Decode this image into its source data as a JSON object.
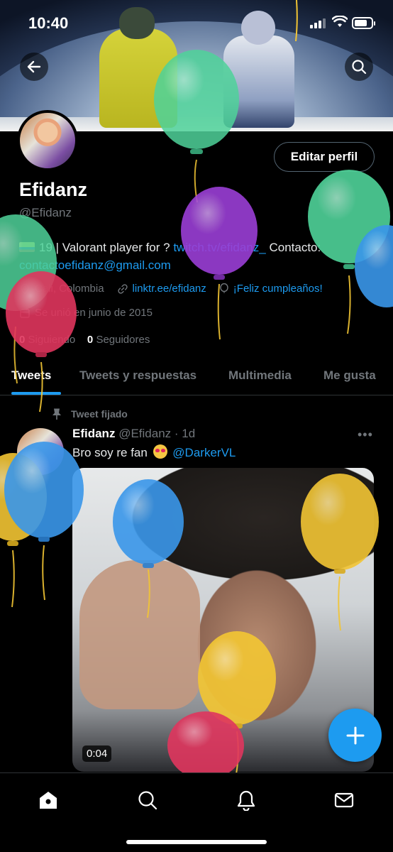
{
  "status_bar": {
    "time": "10:40"
  },
  "profile": {
    "edit_button": "Editar perfil",
    "name": "Efidanz",
    "handle": "@Efidanz",
    "bio_text": "19 | Valorant player for ?",
    "bio_link": "twitch.tv/efidanz_",
    "bio_contact_label": "Contacto:",
    "bio_email": "contactoefidanz@gmail.com",
    "location": "Cali, Colombia",
    "website": "linktr.ee/efidanz",
    "birthday": "¡Feliz cumpleaños!",
    "joined": "Se unió en junio de 2015",
    "following_count": "0",
    "following_label": "Siguiendo",
    "followers_count": "0",
    "followers_label": "Seguidores"
  },
  "tabs": [
    {
      "label": "Tweets",
      "active": true
    },
    {
      "label": "Tweets y respuestas",
      "active": false
    },
    {
      "label": "Multimedia",
      "active": false
    },
    {
      "label": "Me gusta",
      "active": false
    }
  ],
  "tweet": {
    "pinned_label": "Tweet fijado",
    "author_name": "Efidanz",
    "author_handle": "@Efidanz",
    "time": "· 1d",
    "text": "Bro soy re fan",
    "mention": "@DarkerVL",
    "video_duration": "0:04"
  },
  "bottom_nav": [
    "home-icon",
    "search-icon",
    "notifications-icon",
    "messages-icon"
  ],
  "colors": {
    "accent": "#1d9bf0",
    "background": "#000000",
    "secondary_text": "#71767b",
    "balloon_green": "#4fd39a",
    "balloon_purple": "#9b3fd6",
    "balloon_red": "#e0365e",
    "balloon_blue": "#3a97ea",
    "balloon_yellow": "#f2c534"
  }
}
